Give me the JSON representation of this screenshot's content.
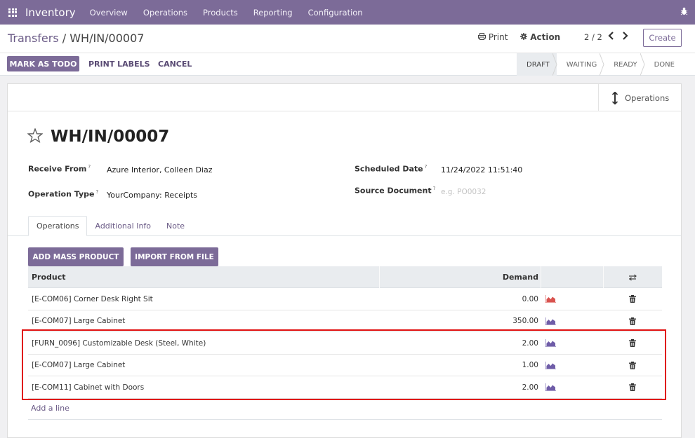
{
  "navbar": {
    "app_name": "Inventory",
    "menu": [
      "Overview",
      "Operations",
      "Products",
      "Reporting",
      "Configuration"
    ]
  },
  "control_panel": {
    "breadcrumb_parent": "Transfers",
    "breadcrumb_sep": " / ",
    "breadcrumb_current": "WH/IN/00007",
    "print_label": "Print",
    "action_label": "Action",
    "pager": "2 / 2",
    "create_label": "Create",
    "mark_todo_label": "MARK AS TODO",
    "print_labels_label": "PRINT LABELS",
    "cancel_label": "CANCEL",
    "stages": [
      "DRAFT",
      "WAITING",
      "READY",
      "DONE"
    ],
    "active_stage": "DRAFT"
  },
  "form": {
    "smart_button_label": "Operations",
    "title": "WH/IN/00007",
    "receive_from_label": "Receive From",
    "receive_from_value": "Azure Interior, Colleen Diaz",
    "operation_type_label": "Operation Type",
    "operation_type_value": "YourCompany: Receipts",
    "scheduled_date_label": "Scheduled Date",
    "scheduled_date_value": "11/24/2022 11:51:40",
    "source_document_label": "Source Document",
    "source_document_placeholder": "e.g. PO0032",
    "help_mark": "?",
    "tabs": [
      "Operations",
      "Additional Info",
      "Note"
    ],
    "active_tab": "Operations",
    "mass_product_label": "ADD MASS PRODUCT",
    "import_label": "IMPORT FROM FILE"
  },
  "table": {
    "col_product": "Product",
    "col_demand": "Demand",
    "rows": [
      {
        "product": "[E-COM06] Corner Desk Right Sit",
        "demand": "0.00",
        "forecast_status": "red"
      },
      {
        "product": "[E-COM07] Large Cabinet",
        "demand": "350.00",
        "forecast_status": "purple"
      },
      {
        "product": "[FURN_0096] Customizable Desk (Steel, White)",
        "demand": "2.00",
        "forecast_status": "purple"
      },
      {
        "product": "[E-COM07] Large Cabinet",
        "demand": "1.00",
        "forecast_status": "purple"
      },
      {
        "product": "[E-COM11] Cabinet with Doors",
        "demand": "2.00",
        "forecast_status": "purple"
      }
    ],
    "add_line_label": "Add a line"
  },
  "colors": {
    "brand": "#7c6b98",
    "highlight": "#e01010",
    "forecast_red": "#d9534f",
    "forecast_purple": "#6f5da8"
  }
}
